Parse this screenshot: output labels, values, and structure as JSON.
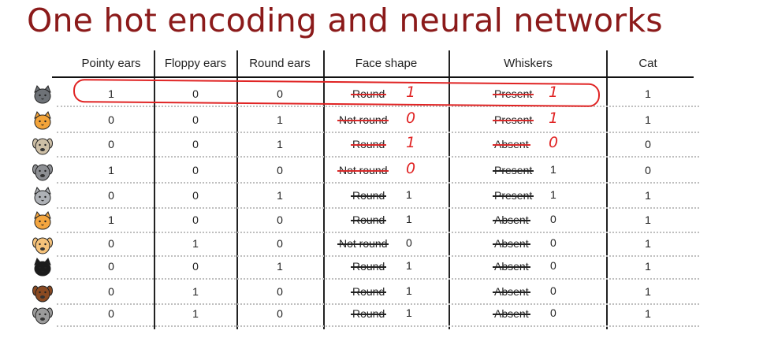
{
  "title": "One hot encoding and neural networks",
  "headers": [
    "Pointy ears",
    "Floppy ears",
    "Round ears",
    "Face shape",
    "Whiskers",
    "Cat"
  ],
  "rows": [
    {
      "animal": "cat-icon",
      "pointy": "1",
      "floppy": "0",
      "round": "0",
      "face": "Round",
      "face_val": "1",
      "face_style": "handwritten",
      "whiskers": "Present",
      "whiskers_val": "1",
      "whiskers_style": "handwritten",
      "cat": "1"
    },
    {
      "animal": "cat-icon",
      "pointy": "0",
      "floppy": "0",
      "round": "1",
      "face": "Not round",
      "face_val": "0",
      "face_style": "handwritten",
      "whiskers": "Present",
      "whiskers_val": "1",
      "whiskers_style": "handwritten",
      "cat": "1"
    },
    {
      "animal": "dog-icon",
      "pointy": "0",
      "floppy": "0",
      "round": "1",
      "face": "Round",
      "face_val": "1",
      "face_style": "handwritten",
      "whiskers": "Absent",
      "whiskers_val": "0",
      "whiskers_style": "handwritten",
      "cat": "0"
    },
    {
      "animal": "dog-icon",
      "pointy": "1",
      "floppy": "0",
      "round": "0",
      "face": "Not round",
      "face_val": "0",
      "face_style": "handwritten",
      "whiskers": "Present",
      "whiskers_val": "1",
      "whiskers_style": "plain",
      "cat": "0"
    },
    {
      "animal": "cat-icon",
      "pointy": "0",
      "floppy": "0",
      "round": "1",
      "face": "Round",
      "face_val": "1",
      "face_style": "plain",
      "whiskers": "Present",
      "whiskers_val": "1",
      "whiskers_style": "plain",
      "cat": "1"
    },
    {
      "animal": "cat-icon",
      "pointy": "1",
      "floppy": "0",
      "round": "0",
      "face": "Round",
      "face_val": "1",
      "face_style": "plain",
      "whiskers": "Absent",
      "whiskers_val": "0",
      "whiskers_style": "plain",
      "cat": "1"
    },
    {
      "animal": "dog-icon",
      "pointy": "0",
      "floppy": "1",
      "round": "0",
      "face": "Not round",
      "face_val": "0",
      "face_style": "plain",
      "whiskers": "Absent",
      "whiskers_val": "0",
      "whiskers_style": "plain",
      "cat": "1"
    },
    {
      "animal": "cat-icon",
      "pointy": "0",
      "floppy": "0",
      "round": "1",
      "face": "Round",
      "face_val": "1",
      "face_style": "plain",
      "whiskers": "Absent",
      "whiskers_val": "0",
      "whiskers_style": "plain",
      "cat": "1"
    },
    {
      "animal": "dog-icon",
      "pointy": "0",
      "floppy": "1",
      "round": "0",
      "face": "Round",
      "face_val": "1",
      "face_style": "plain",
      "whiskers": "Absent",
      "whiskers_val": "0",
      "whiskers_style": "plain",
      "cat": "1"
    },
    {
      "animal": "dog-icon",
      "pointy": "0",
      "floppy": "1",
      "round": "0",
      "face": "Round",
      "face_val": "1",
      "face_style": "plain",
      "whiskers": "Absent",
      "whiskers_val": "0",
      "whiskers_style": "plain",
      "cat": "1"
    }
  ],
  "colors": {
    "title": "#8b1a1a",
    "annotation": "#e02424",
    "animal_fills": [
      "#6e7277",
      "#f3a43a",
      "#cdbfa6",
      "#8d8f93",
      "#aeb1b6",
      "#f4a640",
      "#f5c27a",
      "#1c1c1c",
      "#8a4a22",
      "#9b9b9b"
    ]
  }
}
